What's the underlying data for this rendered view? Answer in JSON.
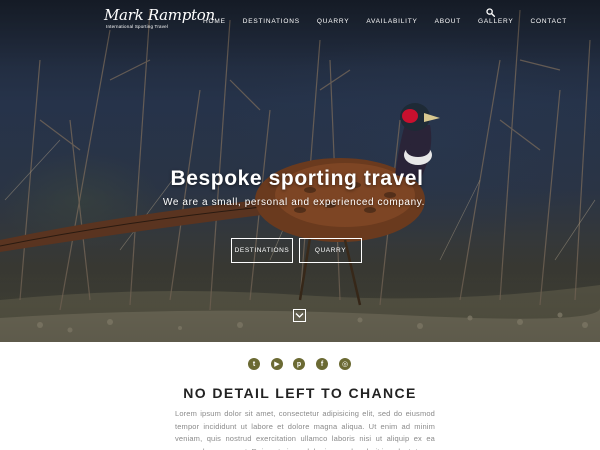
{
  "brand": {
    "logo_script": "Mark Rampton",
    "logo_tagline": "International Sporting Travel"
  },
  "nav": {
    "items": [
      {
        "label": "HOME"
      },
      {
        "label": "DESTINATIONS"
      },
      {
        "label": "QUARRY"
      },
      {
        "label": "AVAILABILITY"
      },
      {
        "label": "ABOUT"
      },
      {
        "label": "GALLERY"
      },
      {
        "label": "CONTACT"
      }
    ],
    "search_icon": "search-icon"
  },
  "hero": {
    "title": "Bespoke sporting travel",
    "subtitle": "We are a small, personal and experienced company.",
    "buttons": [
      {
        "label": "Destinations"
      },
      {
        "label": "Quarry"
      }
    ],
    "scroll_icon": "chevron-down-icon"
  },
  "social": {
    "icons": [
      {
        "name": "twitter-icon",
        "glyph": "t"
      },
      {
        "name": "youtube-icon",
        "glyph": "▶"
      },
      {
        "name": "pinterest-icon",
        "glyph": "p"
      },
      {
        "name": "facebook-icon",
        "glyph": "f"
      },
      {
        "name": "instagram-icon",
        "glyph": "◎"
      }
    ],
    "color": "#6b6a33"
  },
  "content": {
    "heading": "NO DETAIL LEFT TO CHANCE",
    "body": "Lorem ipsum dolor sit amet, consectetur adipisicing elit, sed do eiusmod tempor incididunt ut labore et dolore magna aliqua. Ut enim ad minim veniam, quis nostrud exercitation ullamco laboris nisi ut aliquip ex ea commodo consequat. Duis aute irure dolor in reprehenderit in voluptate"
  }
}
